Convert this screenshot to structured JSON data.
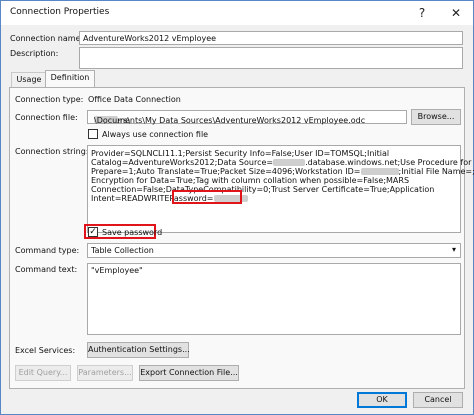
{
  "window": {
    "title": "Connection Properties",
    "help_label": "?",
    "close_label": "✕"
  },
  "connection_name": {
    "label": "Connection name:",
    "value": "AdventureWorks2012 vEmployee"
  },
  "description": {
    "label": "Description:",
    "value": ""
  },
  "tabs": [
    {
      "label": "Usage"
    },
    {
      "label": "Definition"
    }
  ],
  "definition": {
    "connection_type_label": "Connection type:",
    "connection_type_value": "Office Data Connection",
    "connection_file_label": "Connection file:",
    "connection_file_value_prefix": "C:\\Users\\",
    "connection_file_value_suffix": "\\Documents\\My Data Sources\\AdventureWorks2012 vEmployee.odc",
    "browse_label": "Browse...",
    "always_use_label": "Always use connection file",
    "always_use_checked": false,
    "connection_string_label": "Connection string:",
    "connection_string_lines": [
      "Provider=SQLNCLI11.1;Persist Security Info=False;User ID=TOMSQL;Initial",
      "Catalog=AdventureWorks2012;Data Source=",
      ".database.windows.net;Use Procedure for",
      "Prepare=1;Auto Translate=True;Packet Size=4096;Workstation ID=",
      ";Initial File Name=;Use",
      "Encryption for Data=True;Tag with column collation when possible=False;MARS",
      "Connection=False;DataTypeCompatibility=0;Trust Server Certificate=True;Application",
      "Intent=READWRITE",
      "Password="
    ],
    "save_password_label": "Save password",
    "save_password_checked": true,
    "command_type_label": "Command type:",
    "command_type_value": "Table Collection",
    "command_text_label": "Command text:",
    "command_text_value": "\"vEmployee\"",
    "excel_services_label": "Excel Services:",
    "auth_settings_label": "Authentication Settings...",
    "edit_query_label": "Edit Query...",
    "parameters_label": "Parameters...",
    "export_label": "Export Connection File..."
  },
  "footer": {
    "ok_label": "OK",
    "cancel_label": "Cancel"
  },
  "colors": {
    "highlight": "#e0141a",
    "focus": "#0078d7"
  }
}
